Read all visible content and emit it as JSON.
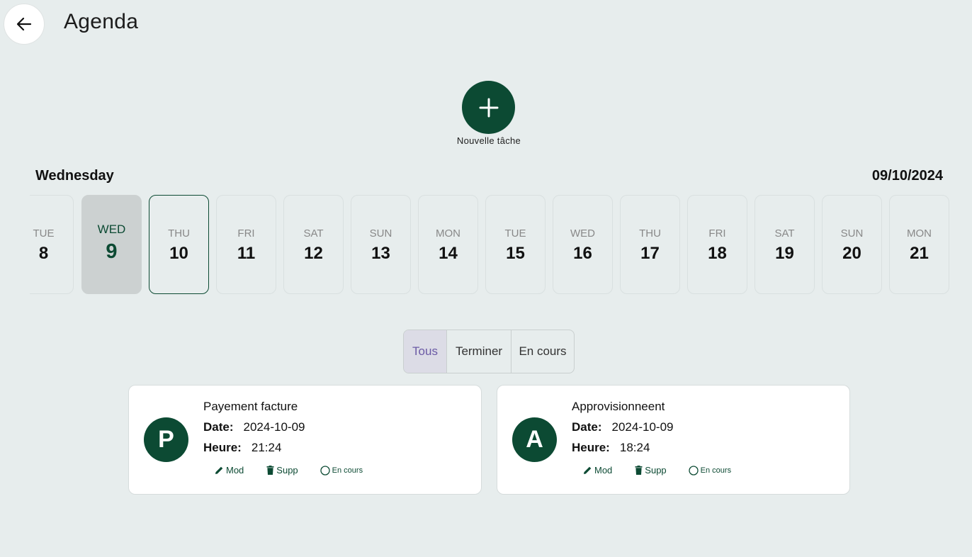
{
  "header": {
    "title": "Agenda",
    "back_icon": "arrow-left-icon"
  },
  "fab": {
    "label": "Nouvelle tâche",
    "icon": "plus-icon"
  },
  "selected": {
    "weekday": "Wednesday",
    "date": "09/10/2024"
  },
  "days": [
    {
      "wd": "TUE",
      "dn": "8"
    },
    {
      "wd": "WED",
      "dn": "9"
    },
    {
      "wd": "THU",
      "dn": "10"
    },
    {
      "wd": "FRI",
      "dn": "11"
    },
    {
      "wd": "SAT",
      "dn": "12"
    },
    {
      "wd": "SUN",
      "dn": "13"
    },
    {
      "wd": "MON",
      "dn": "14"
    },
    {
      "wd": "TUE",
      "dn": "15"
    },
    {
      "wd": "WED",
      "dn": "16"
    },
    {
      "wd": "THU",
      "dn": "17"
    },
    {
      "wd": "FRI",
      "dn": "18"
    },
    {
      "wd": "SAT",
      "dn": "19"
    },
    {
      "wd": "SUN",
      "dn": "20"
    },
    {
      "wd": "MON",
      "dn": "21"
    }
  ],
  "tabs": [
    {
      "label": "Tous"
    },
    {
      "label": "Terminer"
    },
    {
      "label": "En cours"
    }
  ],
  "labels": {
    "date": "Date:",
    "heure": "Heure:",
    "edit": "Mod",
    "delete": "Supp",
    "status": "En cours"
  },
  "tasks": [
    {
      "initial": "P",
      "title": "Payement facture",
      "date": "2024-10-09",
      "time": "21:24"
    },
    {
      "initial": "A",
      "title": "Approvisionneent",
      "date": "2024-10-09",
      "time": "18:24"
    }
  ],
  "colors": {
    "accent": "#0c4a33",
    "background": "#e7eded",
    "selected_day": "#ccd1d1",
    "active_tab_text": "#6b5aa5"
  }
}
